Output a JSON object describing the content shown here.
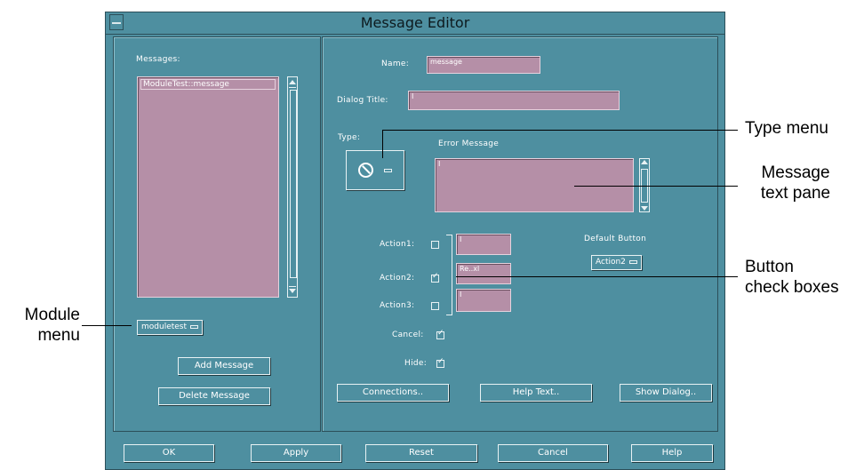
{
  "window": {
    "title": "Message Editor"
  },
  "left": {
    "messages_label": "Messages:",
    "messages": [
      "ModuleTest::message"
    ],
    "module_menu": "moduletest",
    "add_message": "Add Message",
    "delete_message": "Delete Message"
  },
  "right": {
    "name_label": "Name:",
    "name_value": "message",
    "dialog_title_label": "Dialog Title:",
    "dialog_title_value": "I",
    "type_label": "Type:",
    "error_message_label": "Error Message",
    "message_text": "I",
    "action1_label": "Action1:",
    "action1_value": "I",
    "action2_label": "Action2:",
    "action2_value": "Re..xl",
    "action3_label": "Action3:",
    "action3_value": "I",
    "cancel_label": "Cancel:",
    "hide_label": "Hide:",
    "default_button_label": "Default Button",
    "default_button_value": "Action2",
    "connections": "Connections..",
    "help_text": "Help Text..",
    "show_dialog": "Show Dialog.."
  },
  "footer": {
    "ok": "OK",
    "apply": "Apply",
    "reset": "Reset",
    "cancel": "Cancel",
    "help": "Help"
  },
  "callouts": {
    "type_menu": "Type menu",
    "message_text_pane_1": "Message",
    "message_text_pane_2": "text pane",
    "button_check_boxes_1": "Button",
    "button_check_boxes_2": "check boxes",
    "module_menu_1": "Module",
    "module_menu_2": "menu"
  },
  "checkboxes": {
    "action1": false,
    "action2": true,
    "action3": false,
    "cancel": true,
    "hide": true
  },
  "colors": {
    "panel": "#4e8fa0",
    "field": "#b58fa7",
    "text": "#ffffff"
  }
}
